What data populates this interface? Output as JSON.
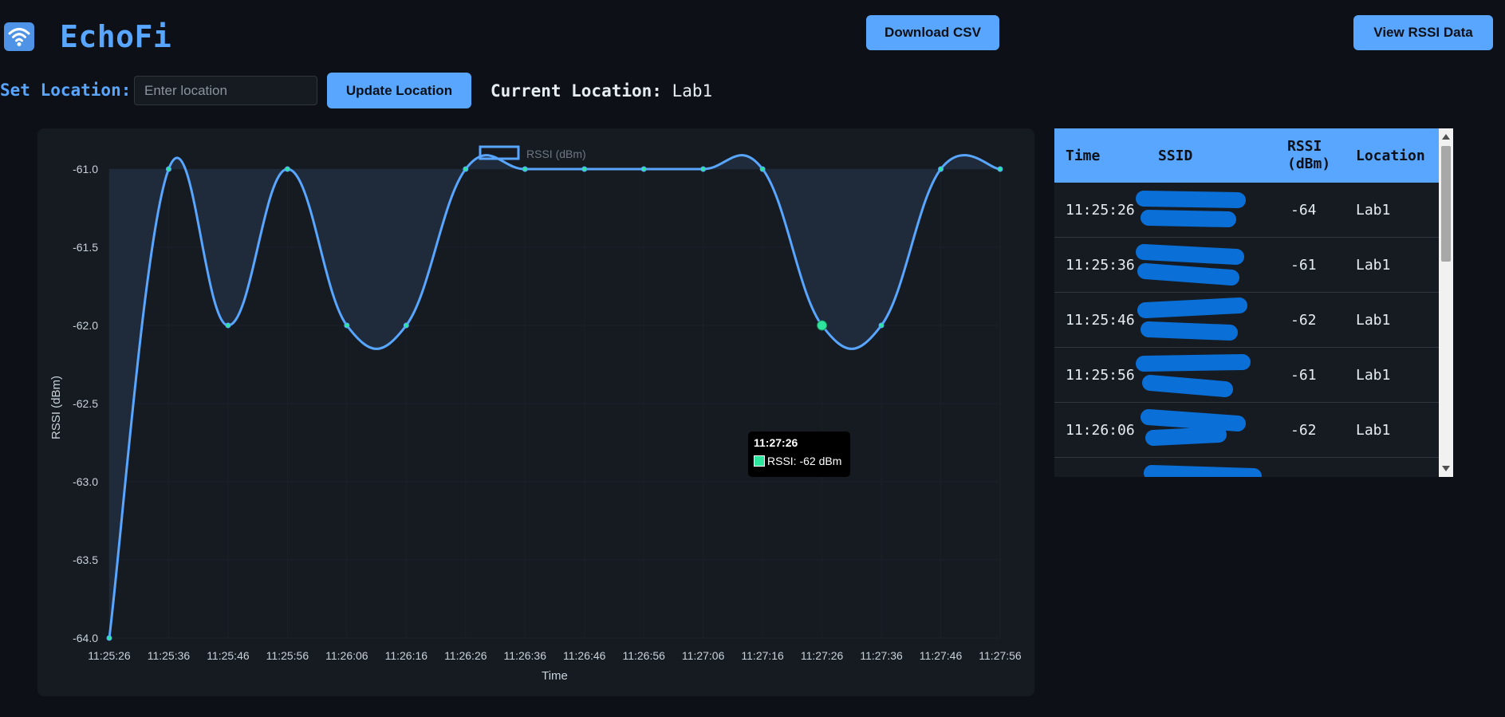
{
  "app": {
    "title": "EchoFi",
    "logo_icon": "wifi-icon"
  },
  "header": {
    "download_csv_label": "Download CSV",
    "view_rssi_label": "View RSSI Data"
  },
  "location": {
    "set_label": "Set Location:",
    "input_placeholder": "Enter location",
    "input_value": "",
    "update_label": "Update Location",
    "current_label": "Current Location:",
    "current_value": "Lab1"
  },
  "chart_data": {
    "type": "line",
    "x": [
      "11:25:26",
      "11:25:36",
      "11:25:46",
      "11:25:56",
      "11:26:06",
      "11:26:16",
      "11:26:26",
      "11:26:36",
      "11:26:46",
      "11:26:56",
      "11:27:06",
      "11:27:16",
      "11:27:26",
      "11:27:36",
      "11:27:46",
      "11:27:56"
    ],
    "series": [
      {
        "name": "RSSI (dBm)",
        "values": [
          -64,
          -61,
          -62,
          -61,
          -62,
          -62,
          -61,
          -61,
          -61,
          -61,
          -61,
          -61,
          -62,
          -62,
          -61,
          -61
        ]
      }
    ],
    "xlabel": "Time",
    "ylabel": "RSSI (dBm)",
    "ylim": [
      -64.0,
      -61.0
    ],
    "yticks": [
      "-61.0",
      "-61.5",
      "-62.0",
      "-62.5",
      "-63.0",
      "-63.5",
      "-64.0"
    ],
    "legend": "top",
    "filled": true,
    "colors": {
      "line": "#58a6ff",
      "point": "#2ee59d",
      "fill": "#1f2a3a"
    },
    "tooltip": {
      "title": "11:27:26",
      "label": "RSSI: -62 dBm",
      "index": 12
    }
  },
  "table": {
    "headers": {
      "time": "Time",
      "ssid": "SSID",
      "rssi": "RSSI (dBm)",
      "location": "Location"
    },
    "rows": [
      {
        "time": "11:25:26",
        "rssi": "-64",
        "location": "Lab1"
      },
      {
        "time": "11:25:36",
        "rssi": "-61",
        "location": "Lab1"
      },
      {
        "time": "11:25:46",
        "rssi": "-62",
        "location": "Lab1"
      },
      {
        "time": "11:25:56",
        "rssi": "-61",
        "location": "Lab1"
      },
      {
        "time": "11:26:06",
        "rssi": "-62",
        "location": "Lab1"
      }
    ],
    "redaction_color": "#0a6fd6"
  }
}
